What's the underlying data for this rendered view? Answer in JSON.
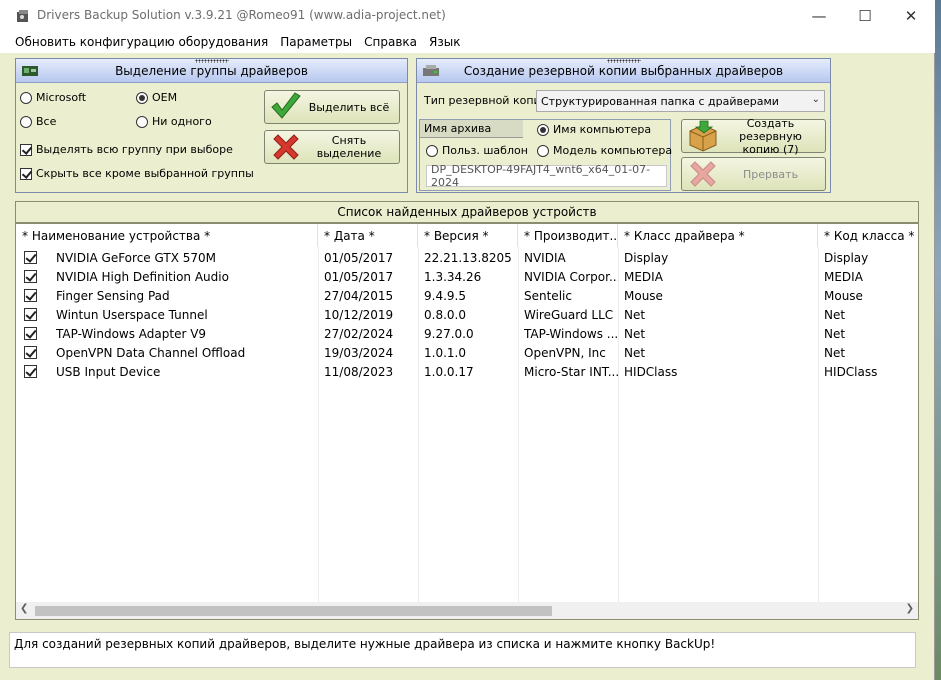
{
  "window": {
    "title": "Drivers Backup Solution v.3.9.21 @Romeo91 (www.adia-project.net)"
  },
  "menu": [
    "Обновить конфигурацию оборудования",
    "Параметры",
    "Справка",
    "Язык"
  ],
  "selection_panel": {
    "title": "Выделение группы драйверов",
    "radios": [
      {
        "label": "Microsoft",
        "checked": false
      },
      {
        "label": "OEM",
        "checked": true
      },
      {
        "label": "Все",
        "checked": false
      },
      {
        "label": "Ни одного",
        "checked": false
      }
    ],
    "checks": [
      {
        "label": "Выделять всю группу при выборе",
        "checked": true
      },
      {
        "label": "Скрыть все кроме выбранной группы",
        "checked": true
      }
    ],
    "select_all_label": "Выделить всё",
    "deselect_label": "Снять выделение"
  },
  "backup_panel": {
    "title": "Создание резервной копии выбранных драйверов",
    "type_label": "Тип резервной копии",
    "type_value": "Структурированная папка с драйверами",
    "archive_tab": "Имя архива",
    "name_options": [
      {
        "label": "Имя компьютера",
        "checked": true
      },
      {
        "label": "Польз. шаблон",
        "checked": false
      },
      {
        "label": "Модель компьютера",
        "checked": false
      }
    ],
    "archive_name": "DP_DESKTOP-49FAJT4_wnt6_x64_01-07-2024",
    "create_label": "Создать резервную копию (7)",
    "abort_label": "Прервать"
  },
  "list": {
    "title": "Список найденных драйверов устройств",
    "columns": [
      "* Наименование устройства *",
      "* Дата *",
      "* Версия *",
      "* Производит...",
      "* Класс драйвера *",
      "* Код класса *"
    ],
    "rows": [
      [
        "NVIDIA GeForce GTX 570M",
        "01/05/2017",
        "22.21.13.8205",
        "NVIDIA",
        "Display",
        "Display"
      ],
      [
        "NVIDIA High Definition Audio",
        "01/05/2017",
        "1.3.34.26",
        "NVIDIA Corpor...",
        "MEDIA",
        "MEDIA"
      ],
      [
        "Finger Sensing Pad",
        "27/04/2015",
        "9.4.9.5",
        "Sentelic",
        "Mouse",
        "Mouse"
      ],
      [
        "Wintun Userspace Tunnel",
        "10/12/2019",
        "0.8.0.0",
        "WireGuard LLC",
        "Net",
        "Net"
      ],
      [
        "TAP-Windows Adapter V9",
        "27/02/2024",
        "9.27.0.0",
        "TAP-Windows ...",
        "Net",
        "Net"
      ],
      [
        "OpenVPN Data Channel Offload",
        "19/03/2024",
        "1.0.1.0",
        "OpenVPN, Inc",
        "Net",
        "Net"
      ],
      [
        "USB Input Device",
        "11/08/2023",
        "1.0.0.17",
        "Micro-Star INT...",
        "HIDClass",
        "HIDClass"
      ]
    ]
  },
  "status": "Для созданий резервных копий драйверов, выделите нужные драйвера из списка и нажмите кнопку BackUp!"
}
